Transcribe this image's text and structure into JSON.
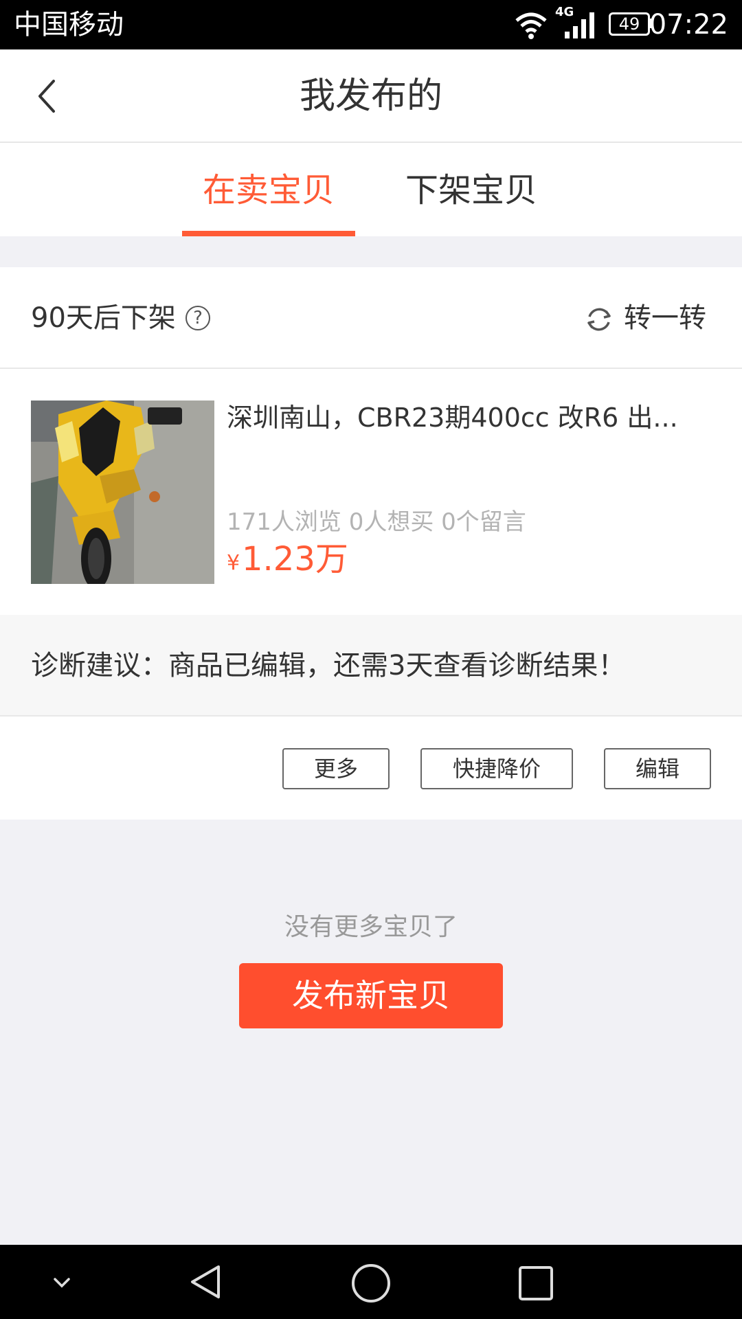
{
  "status_bar": {
    "carrier": "中国移动",
    "network": "4G",
    "battery": "49",
    "time": "07:22"
  },
  "header": {
    "title": "我发布的"
  },
  "tabs": [
    {
      "label": "在卖宝贝"
    },
    {
      "label": "下架宝贝"
    }
  ],
  "item_card": {
    "expire_text": "90天后下架",
    "help_symbol": "?",
    "rotate_label": "转一转",
    "title": "深圳南山，CBR23期400cc 改R6 出...",
    "stats": "171人浏览 0人想买 0个留言",
    "price_symbol": "¥",
    "price": "1.23万",
    "diagnosis": "诊断建议：商品已编辑，还需3天查看诊断结果！",
    "buttons": {
      "more": "更多",
      "quick_price_drop": "快捷降价",
      "edit": "编辑"
    }
  },
  "footer": {
    "no_more_text": "没有更多宝贝了",
    "publish_button": "发布新宝贝"
  },
  "colors": {
    "accent": "#ff5b36",
    "publish_button": "#ff4e2e"
  }
}
